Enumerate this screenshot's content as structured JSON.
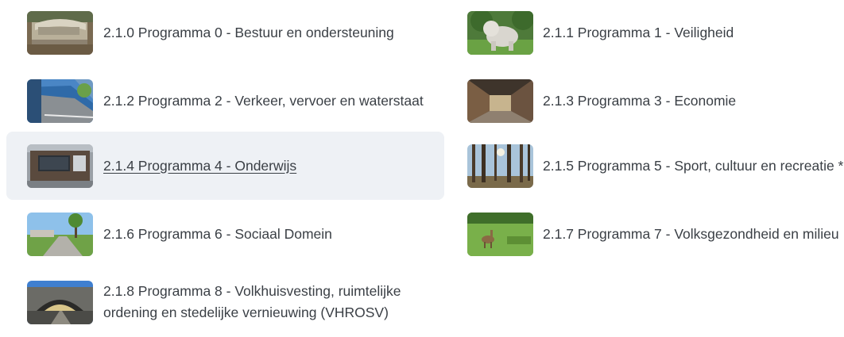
{
  "left_items": [
    {
      "label": "2.1.0 Programma 0 - Bestuur en ondersteuning",
      "thumb": "bench-photo"
    },
    {
      "label": "2.1.2 Programma 2 - Verkeer, vervoer en waterstaat",
      "thumb": "tunnel-road-photo"
    },
    {
      "label": "2.1.4 Programma 4 - Onderwijs",
      "thumb": "school-building-photo",
      "active": true
    },
    {
      "label": "2.1.6 Programma 6 - Sociaal Domein",
      "thumb": "park-path-photo"
    },
    {
      "label": "2.1.8 Programma 8 - Volkhuisvesting, ruimtelijke ordening en stedelijke vernieuwing (VHROSV)",
      "thumb": "underpass-photo"
    }
  ],
  "right_items": [
    {
      "label": "2.1.1 Programma 1 - Veiligheid",
      "thumb": "bulldog-statue-photo"
    },
    {
      "label": "2.1.3 Programma 3 - Economie",
      "thumb": "shopping-arcade-photo"
    },
    {
      "label": "2.1.5 Programma 5 - Sport, cultuur en recreatie *",
      "thumb": "forest-photo"
    },
    {
      "label": "2.1.7 Programma 7 - Volksgezondheid en milieu",
      "thumb": "deer-meadow-photo"
    }
  ],
  "colors": {
    "text": "#3a3f45",
    "active_background": "#eef1f5"
  }
}
